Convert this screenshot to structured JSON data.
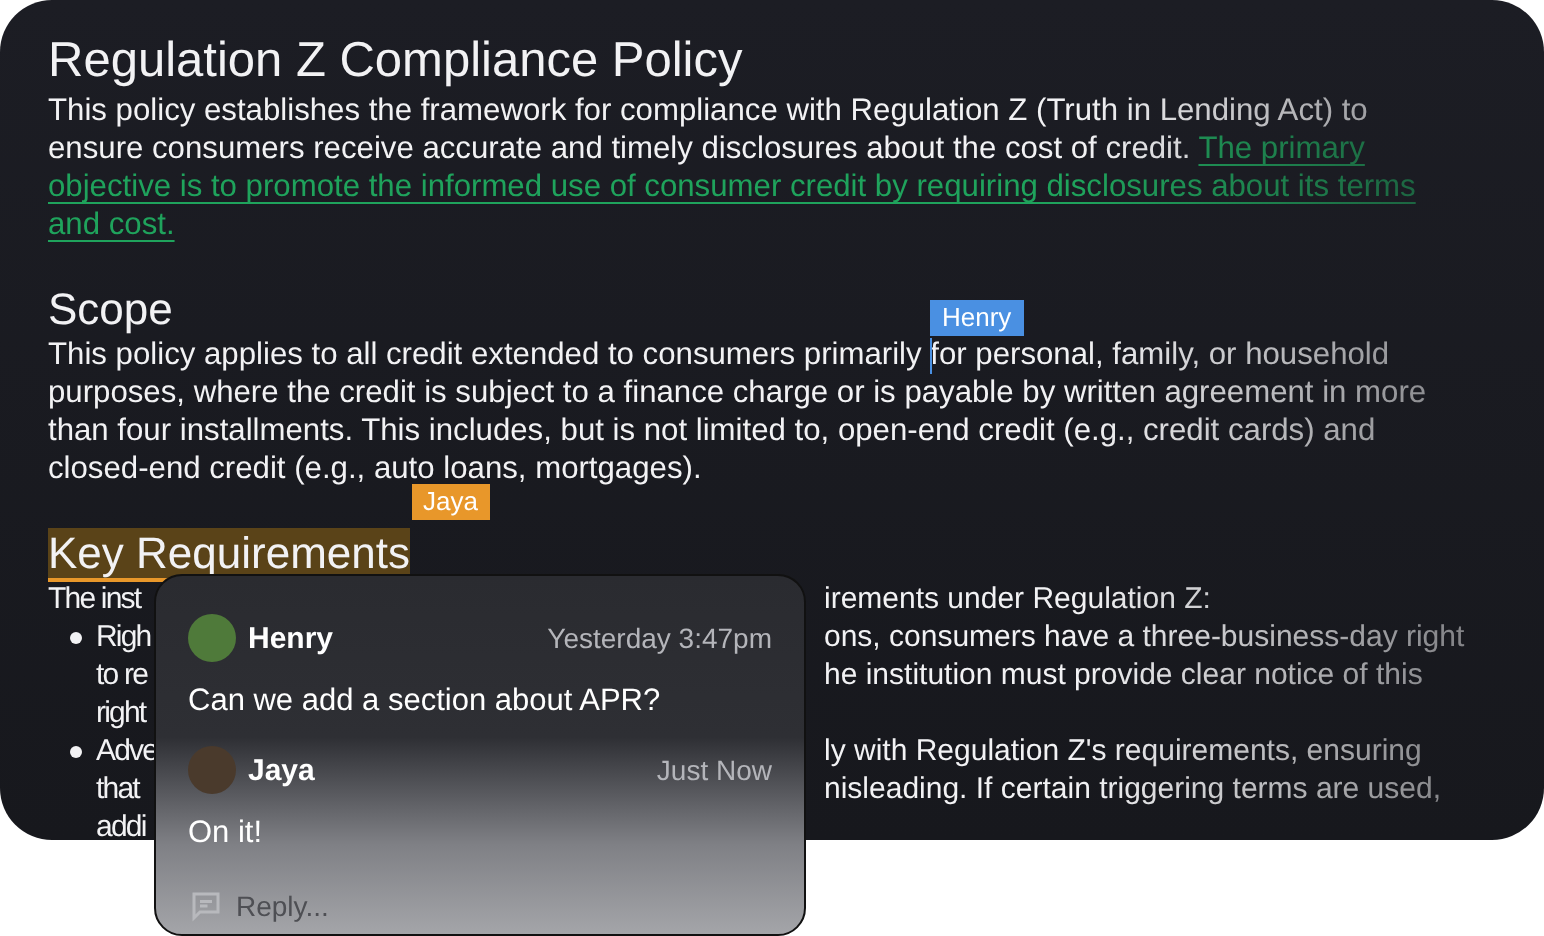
{
  "title": "Regulation Z Compliance Policy",
  "intro": {
    "text": "This policy establishes the framework for compliance with Regulation Z (Truth in Lending Act) to ensure consumers receive accurate and timely disclosures about the cost of credit. ",
    "highlight": "The primary objective is to promote the informed use of consumer credit by requiring disclosures about its terms and cost."
  },
  "scope": {
    "heading": "Scope",
    "before": "This policy applies to all credit extended to consumers primarily",
    "after": "for personal, family, or household purposes, where the credit is subject to a finance charge or is payable by written agreement in more than four installments. This includes, but is not limited to, open-end credit (e.g., credit cards) and closed-end credit (e.g., auto loans, mortgages).",
    "cursor": {
      "name": "Henry",
      "color": "#4a90e2"
    }
  },
  "key": {
    "heading": "Key Requirements",
    "tag": {
      "name": "Jaya",
      "color": "#e8972a"
    },
    "lines": [
      {
        "kind": "text",
        "left": "The inst",
        "right": "irements under Regulation Z:"
      },
      {
        "kind": "bullet",
        "left": "Righ",
        "right": "ons, consumers have a three-business-day right"
      },
      {
        "kind": "cont",
        "left": "to re",
        "right": "he institution must provide clear notice of this"
      },
      {
        "kind": "cont",
        "left": "right"
      },
      {
        "kind": "bullet",
        "left": "Adve",
        "right": "ly with Regulation Z's requirements, ensuring"
      },
      {
        "kind": "cont",
        "left": "that",
        "right": "nisleading. If certain triggering terms are used,"
      },
      {
        "kind": "cont",
        "left": "addi"
      }
    ]
  },
  "comments": [
    {
      "author": "Henry",
      "time": "Yesterday 3:47pm",
      "text": "Can we add a section about APR?",
      "color": "#4f7a3a"
    },
    {
      "author": "Jaya",
      "time": "Just Now",
      "text": "On it!",
      "color": "#4a3a2c"
    }
  ],
  "reply": {
    "placeholder": "Reply..."
  }
}
